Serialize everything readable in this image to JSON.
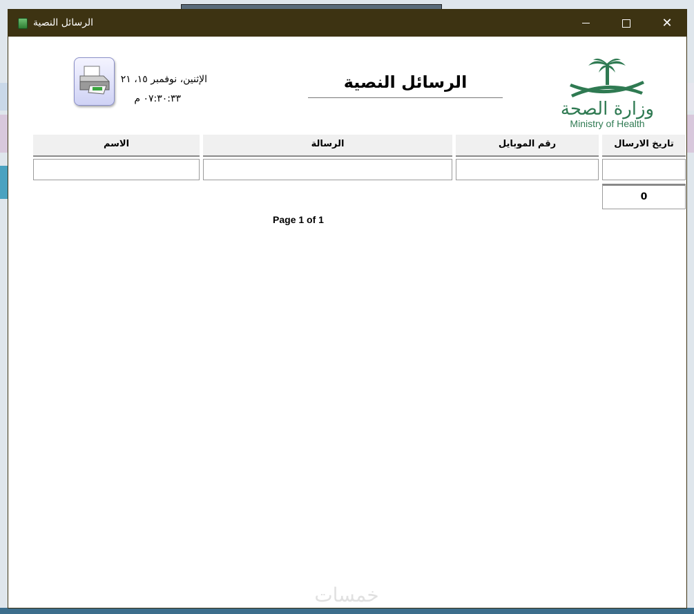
{
  "window": {
    "title": "الرسائل النصية",
    "minimize_icon": "minimize-icon",
    "maximize_icon": "maximize-icon",
    "close_glyph": "✕"
  },
  "header": {
    "logo_ar": "وزارة الصحة",
    "logo_en": "Ministry of Health",
    "report_title": "الرسائل النصية",
    "date": "الإثنين، نوفمبر ١٥، ٢١",
    "time": "٠٧:٣٠:٣٣ م",
    "print_icon": "printer-icon"
  },
  "table": {
    "columns": [
      "تاريخ الارسال",
      "رقم الموبايل",
      "الرسالة",
      "الاسم"
    ],
    "rows": [
      [
        "",
        "",
        "",
        ""
      ]
    ],
    "total": "0"
  },
  "footer": {
    "page": "Page 1 of 1",
    "watermark": "خمسات"
  },
  "colors": {
    "titlebar": "#3d3312",
    "brand_green": "#2f7a52",
    "header_bg": "#f0f0f0"
  }
}
